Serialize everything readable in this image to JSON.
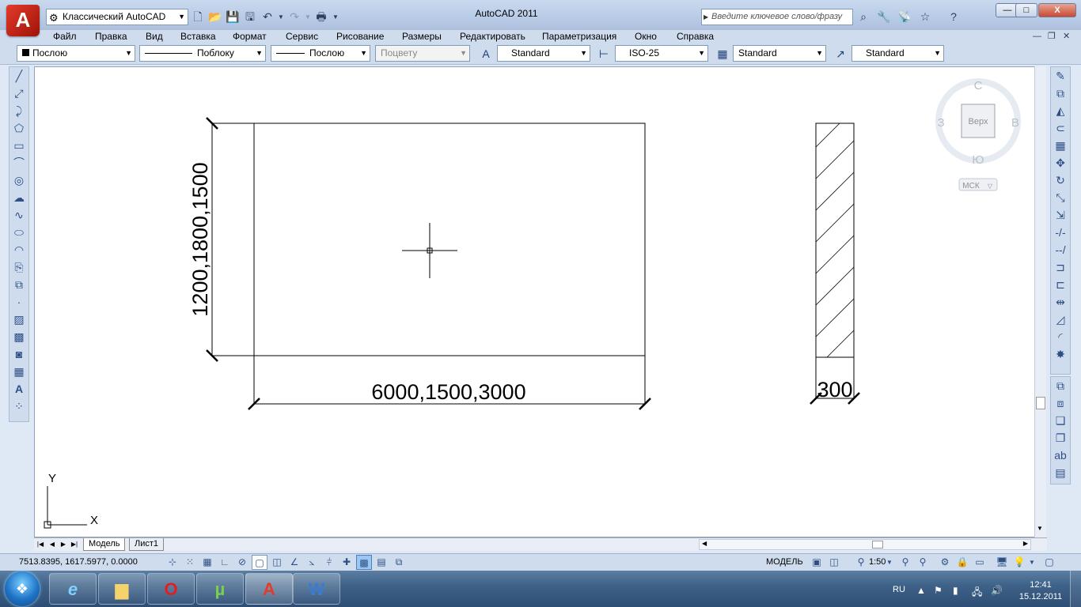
{
  "titlebar": {
    "workspace": "Классический AutoCAD",
    "title": "AutoCAD 2011",
    "search_placeholder": "Введите ключевое слово/фразу",
    "min_label": "—",
    "max_label": "□",
    "close_label": "X"
  },
  "menu": {
    "items": [
      "Файл",
      "Правка",
      "Вид",
      "Вставка",
      "Формат",
      "Сервис",
      "Рисование",
      "Размеры",
      "Редактировать",
      "Параметризация",
      "Окно",
      "Справка"
    ],
    "mdi": [
      "—",
      "❐",
      "✕"
    ]
  },
  "properties": {
    "color": "Послою",
    "linetype": "Поблоку",
    "lineweight": "Послою",
    "plotstyle": "Поцвету",
    "text_style": "Standard",
    "dim_style": "ISO-25",
    "table_style": "Standard",
    "multileader_style": "Standard"
  },
  "drawing": {
    "dim_height": "1200,1800,1500",
    "dim_width": "6000,1500,3000",
    "dim_thickness": "300",
    "ucs_x": "X",
    "ucs_y": "Y"
  },
  "viewcube": {
    "north": "С",
    "south": "Ю",
    "west": "З",
    "east": "В",
    "face": "Верх",
    "wcs": "МСК"
  },
  "tabs": [
    "Модель",
    "Лист1"
  ],
  "status": {
    "coords": "7513.8395, 1617.5977, 0.0000",
    "model": "МОДЕЛЬ",
    "scale": "1:50"
  },
  "taskbar": {
    "lang": "RU",
    "time": "12:41",
    "date": "15.12.2011"
  },
  "colors": {
    "autocad_red": "#d9261c",
    "canvas_bg": "#ffffff",
    "ui_blue": "#cfdcee"
  }
}
